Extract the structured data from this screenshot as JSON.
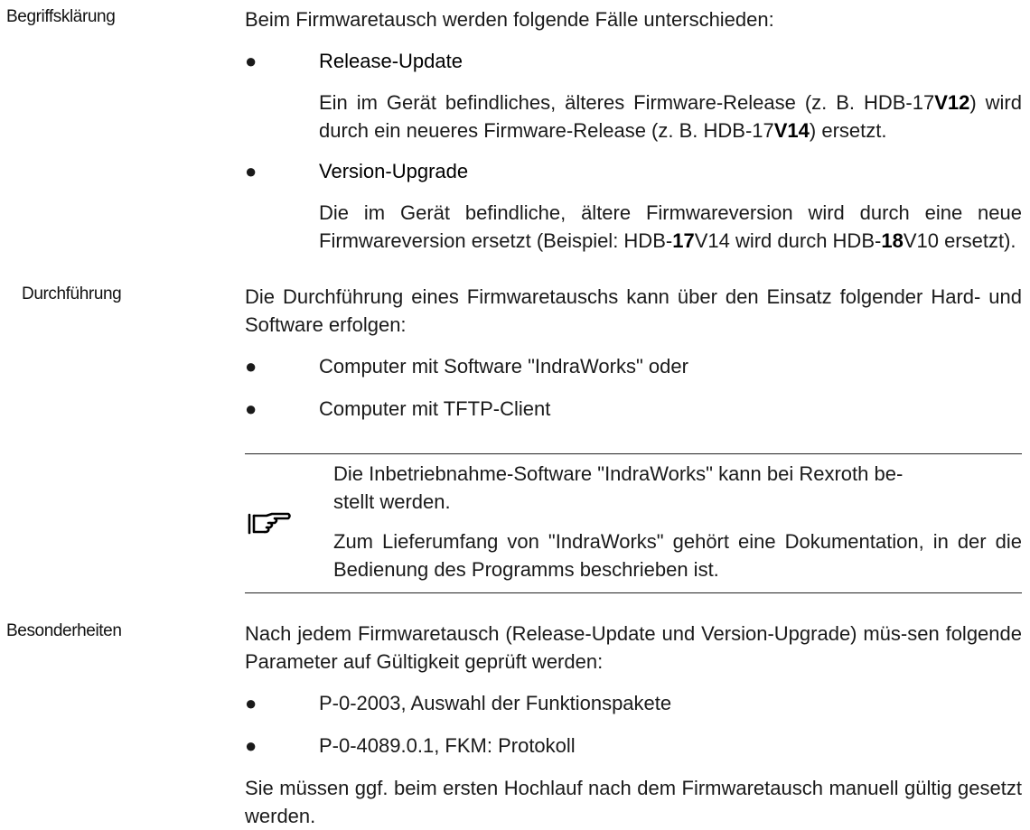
{
  "sections": {
    "begriff": {
      "label": "Begriffsklärung",
      "intro": "Beim Firmwaretausch werden folgende Fälle unterschieden:",
      "release": {
        "title": "Release-Update",
        "pre1": "Ein im Gerät befindliches, älteres Firmware-Release (z. B. HDB-17",
        "bold1": "V12",
        "mid": ") wird durch ein neueres Firmware-Release (z. B. HDB-17",
        "bold2": "V14",
        "post": ") ersetzt."
      },
      "version": {
        "title": "Version-Upgrade",
        "pre": "Die im Gerät befindliche, ältere Firmwareversion wird durch eine neue Firmwareversion ersetzt (Beispiel: HDB-",
        "bold1": "17",
        "mid": "V14 wird durch HDB-",
        "bold2": "18",
        "post": "V10 ersetzt)."
      }
    },
    "durchfuehrung": {
      "label": "Durchführung",
      "intro": "Die Durchführung eines Firmwaretauschs kann über den Einsatz folgender Hard- und Software erfolgen:",
      "items": [
        "Computer mit Software \"IndraWorks\" oder",
        "Computer mit TFTP-Client"
      ],
      "note": {
        "line1": "Die Inbetriebnahme-Software \"IndraWorks\" kann bei Rexroth be-",
        "line1b": "stellt werden.",
        "para2": "Zum Lieferumfang von \"IndraWorks\" gehört eine Dokumentation, in der die Bedienung des Programms beschrieben ist."
      }
    },
    "besonderheiten": {
      "label": "Besonderheiten",
      "intro": "Nach jedem Firmwaretausch (Release-Update und Version-Upgrade) müs-sen folgende Parameter auf Gültigkeit geprüft werden:",
      "items": [
        "P-0-2003, Auswahl der Funktionspakete",
        "P-0-4089.0.1, FKM: Protokoll"
      ],
      "outro": "Sie müssen ggf. beim ersten Hochlauf nach dem Firmwaretausch manuell gültig gesetzt werden."
    }
  },
  "bullet_glyph": "●",
  "icons": {
    "note": "pointing-hand-icon"
  }
}
